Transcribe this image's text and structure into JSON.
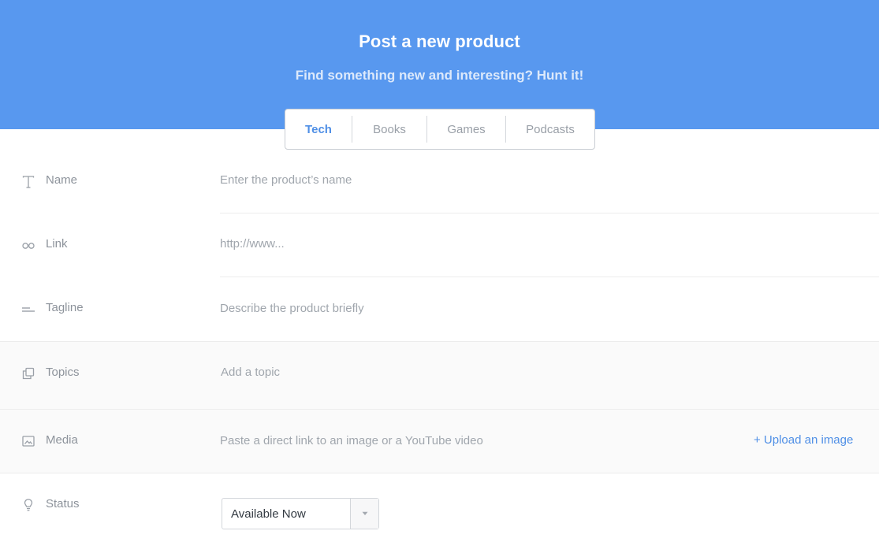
{
  "header": {
    "title": "Post a new product",
    "subtitle": "Find something new and interesting? Hunt it!"
  },
  "tabs": [
    {
      "label": "Tech",
      "active": true
    },
    {
      "label": "Books",
      "active": false
    },
    {
      "label": "Games",
      "active": false
    },
    {
      "label": "Podcasts",
      "active": false
    }
  ],
  "form": {
    "name": {
      "label": "Name",
      "placeholder": "Enter the product’s name",
      "icon": "text-icon"
    },
    "link": {
      "label": "Link",
      "placeholder": "http://www...",
      "icon": "infinity-link-icon"
    },
    "tagline": {
      "label": "Tagline",
      "placeholder": "Describe the product briefly",
      "icon": "lines-icon"
    },
    "topics": {
      "label": "Topics",
      "placeholder": "Add a topic",
      "icon": "stacked-squares-icon"
    },
    "media": {
      "label": "Media",
      "placeholder": "Paste a direct link to an image or a YouTube video",
      "icon": "image-icon",
      "upload_label": "+ Upload an image"
    },
    "status": {
      "label": "Status",
      "selected": "Available Now",
      "icon": "lightbulb-icon"
    }
  },
  "colors": {
    "header_bg": "#5898ef",
    "accent": "#4f8fe6"
  }
}
